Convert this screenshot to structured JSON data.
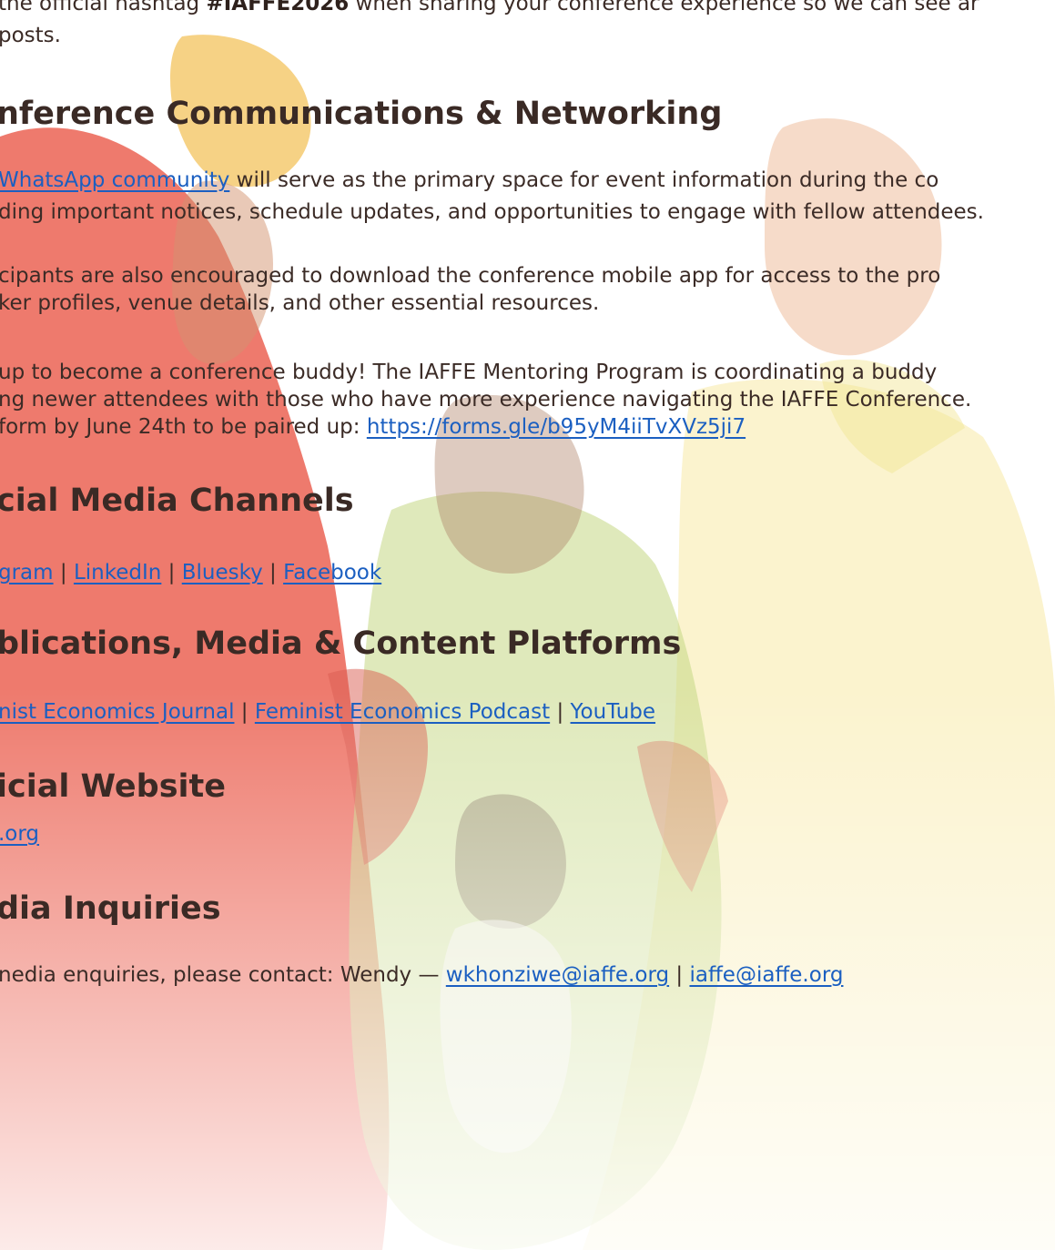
{
  "hashtag_intro": {
    "line1_before": "the official hashtag ",
    "hashtag": "#IAFFE2026",
    "line1_after": " when sharing your conference experience so we can see ar",
    "line2": "posts."
  },
  "communications": {
    "heading": "nference Communications & Networking",
    "whatsapp_link": "WhatsApp community",
    "whatsapp_line1_after": " will serve as the primary space for event information during the co",
    "whatsapp_line2": "ding important notices, schedule updates, and opportunities to engage with fellow attendees.",
    "app_line1": "cipants are also encouraged to download the conference mobile app for access to the pro",
    "app_line2": "ker profiles, venue details, and other essential resources.",
    "buddy_line1": "up to become a conference buddy! The IAFFE Mentoring Program is coordinating a buddy",
    "buddy_line2": "ng newer attendees with those who have more experience navigating the IAFFE Conference.",
    "buddy_line3_before": "form by June 24th  to be paired up: ",
    "buddy_form_link": "https://forms.gle/b95yM4iiTvXVz5ji7"
  },
  "social": {
    "heading": "cial Media Channels",
    "links": [
      "gram",
      "LinkedIn",
      "Bluesky",
      "Facebook"
    ],
    "separator": "|"
  },
  "publications": {
    "heading": "blications, Media & Content Platforms",
    "links": [
      "nist Economics Journal",
      "Feminist Economics Podcast",
      "YouTube"
    ],
    "separator": "|"
  },
  "website": {
    "heading": "icial Website",
    "link": ".org"
  },
  "media": {
    "heading": "dia Inquiries",
    "text_before": "nedia enquiries, please contact: Wendy — ",
    "email1": "wkhonziwe@iaffe.org",
    "separator": "|",
    "email2": "iaffe@iaffe.org"
  },
  "colors": {
    "link": "#1b5fc1",
    "text": "#3b2b26",
    "background_art_red": "#e23a2a",
    "background_art_yellow": "#f6e36a"
  }
}
